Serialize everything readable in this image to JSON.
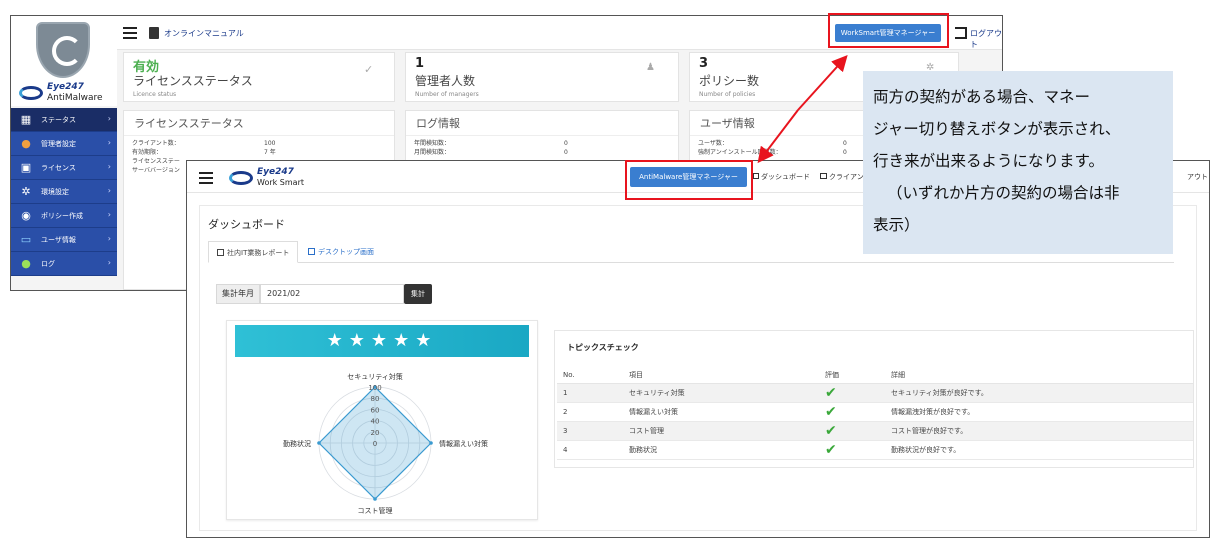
{
  "back_app": {
    "brand_line1": "Eye247",
    "brand_line2": "AntiMalware",
    "menu": [
      {
        "label": "ステータス",
        "icon": "status-icon",
        "active": true
      },
      {
        "label": "管理者設定",
        "icon": "admin-user-icon",
        "active": false
      },
      {
        "label": "ライセンス",
        "icon": "lock-icon",
        "active": false
      },
      {
        "label": "環境設定",
        "icon": "gear-icon",
        "active": false
      },
      {
        "label": "ポリシー作成",
        "icon": "policy-icon",
        "active": false
      },
      {
        "label": "ユーザ情報",
        "icon": "monitor-icon",
        "active": false
      },
      {
        "label": "ログ",
        "icon": "chat-icon",
        "active": false
      }
    ],
    "topbar": {
      "manual_link": "オンラインマニュアル",
      "workspace_button": "WorkSmart管理マネージャー",
      "logout": "ログアウト"
    },
    "cards": [
      {
        "big": "有効",
        "sub": "ライセンスステータス",
        "small": "Licence status",
        "icon": "check-icon"
      },
      {
        "big": "1",
        "sub": "管理者人数",
        "small": "Number of managers",
        "icon": "person-icon"
      },
      {
        "big": "3",
        "sub": "ポリシー数",
        "small": "Number of policies",
        "icon": "gear-icon"
      }
    ],
    "sections": {
      "license": {
        "title": "ライセンスステータス",
        "rows": [
          {
            "k": "クライアント数：",
            "v": "100"
          },
          {
            "k": "有効期限：",
            "v": "7 年"
          },
          {
            "k": "ライセンスステー",
            "v": ""
          },
          {
            "k": "サーババージョン",
            "v": ""
          }
        ]
      },
      "log": {
        "title": "ログ情報",
        "rows": [
          {
            "k": "年間検知数：",
            "v": "0"
          },
          {
            "k": "月間検知数：",
            "v": "0"
          }
        ]
      },
      "user": {
        "title": "ユーザ情報",
        "rows": [
          {
            "k": "ユーザ数：",
            "v": "0"
          },
          {
            "k": "強制アンインストール回数数：",
            "v": "0"
          }
        ]
      }
    }
  },
  "front_app": {
    "brand_line1": "Eye247",
    "brand_line2": "Work Smart",
    "topbar": {
      "antimalware_button": "AntiMalware管理マネージャー",
      "dashboard_link": "ダッシュボード",
      "client_link": "クライアン",
      "logout_fragment": "アウト"
    },
    "page_title": "ダッシュボード",
    "tabs": [
      {
        "label": "社内IT業務レポート",
        "active": true
      },
      {
        "label": "デスクトップ画面",
        "active": false
      }
    ],
    "filter": {
      "label": "集計年月",
      "value": "2021/02",
      "button": "集計"
    },
    "stars": "★★★★★",
    "topics": {
      "title": "トピックスチェック",
      "headers": [
        "No.",
        "項目",
        "評価",
        "詳細"
      ],
      "rows": [
        {
          "no": "1",
          "item": "セキュリティ対策",
          "rating": "✔",
          "detail": "セキュリティ対策が良好です。"
        },
        {
          "no": "2",
          "item": "情報漏えい対策",
          "rating": "✔",
          "detail": "情報漏洩対策が良好です。"
        },
        {
          "no": "3",
          "item": "コスト管理",
          "rating": "✔",
          "detail": "コスト管理が良好です。"
        },
        {
          "no": "4",
          "item": "勤務状況",
          "rating": "✔",
          "detail": "勤務状況が良好です。"
        }
      ]
    }
  },
  "chart_data": {
    "type": "radar",
    "categories": [
      "セキュリティ対策",
      "情報漏えい対策",
      "コスト管理",
      "勤務状況"
    ],
    "values": [
      100,
      100,
      100,
      100
    ],
    "ticks": [
      "0",
      "20",
      "40",
      "60",
      "80",
      "100"
    ],
    "ylim": [
      0,
      100
    ],
    "color": "#3a9ad0"
  },
  "callout": {
    "lines": [
      "両方の契約がある場合、マネー",
      "ジャー切り替えボタンが表示され、",
      "行き来が出来るようになります。",
      "（いずれか片方の契約の場合は非",
      "表示）"
    ]
  }
}
